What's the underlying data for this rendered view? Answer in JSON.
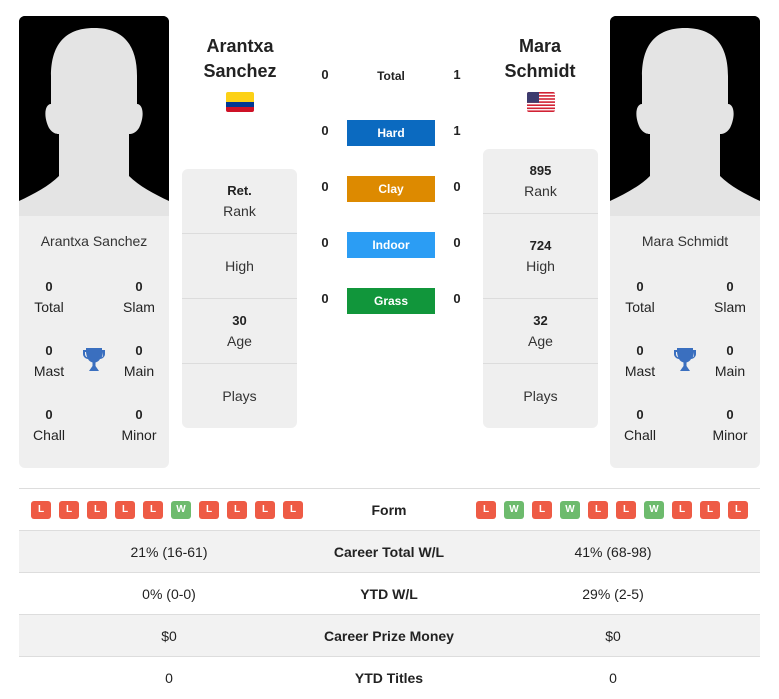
{
  "colors": {
    "hard": "#0b6ac0",
    "clay": "#dd8a00",
    "indoor": "#2b9df4",
    "grass": "#11963b",
    "loss": "#ee5b45",
    "win": "#6dbb6d",
    "trophy": "#3a6fbf"
  },
  "player1": {
    "first_name": "Arantxa",
    "last_name": "Sanchez",
    "full_name": "Arantxa Sanchez",
    "flag": "colombia-flag",
    "rank_value": "Ret.",
    "rank_label": "Rank",
    "high_value": "",
    "high_label": "High",
    "age_value": "30",
    "age_label": "Age",
    "plays_label": "Plays",
    "titles": {
      "total": "0",
      "total_label": "Total",
      "slam": "0",
      "slam_label": "Slam",
      "mast": "0",
      "mast_label": "Mast",
      "main": "0",
      "main_label": "Main",
      "chall": "0",
      "chall_label": "Chall",
      "minor": "0",
      "minor_label": "Minor"
    },
    "form": [
      "L",
      "L",
      "L",
      "L",
      "L",
      "W",
      "L",
      "L",
      "L",
      "L"
    ]
  },
  "player2": {
    "first_name": "Mara",
    "last_name": "Schmidt",
    "full_name": "Mara Schmidt",
    "flag": "usa-flag",
    "rank_value": "895",
    "rank_label": "Rank",
    "high_value": "724",
    "high_label": "High",
    "age_value": "32",
    "age_label": "Age",
    "plays_label": "Plays",
    "titles": {
      "total": "0",
      "total_label": "Total",
      "slam": "0",
      "slam_label": "Slam",
      "mast": "0",
      "mast_label": "Mast",
      "main": "0",
      "main_label": "Main",
      "chall": "0",
      "chall_label": "Chall",
      "minor": "0",
      "minor_label": "Minor"
    },
    "form": [
      "L",
      "W",
      "L",
      "W",
      "L",
      "L",
      "W",
      "L",
      "L",
      "L"
    ]
  },
  "h2h": {
    "total": {
      "label": "Total",
      "p1": "0",
      "p2": "1"
    },
    "surfaces": [
      {
        "label": "Hard",
        "p1": "0",
        "p2": "1"
      },
      {
        "label": "Clay",
        "p1": "0",
        "p2": "0"
      },
      {
        "label": "Indoor",
        "p1": "0",
        "p2": "0"
      },
      {
        "label": "Grass",
        "p1": "0",
        "p2": "0"
      }
    ]
  },
  "comparison": {
    "form_label": "Form",
    "rows": [
      {
        "label": "Career Total W/L",
        "p1": "21% (16-61)",
        "p2": "41% (68-98)"
      },
      {
        "label": "YTD W/L",
        "p1": "0% (0-0)",
        "p2": "29% (2-5)"
      },
      {
        "label": "Career Prize Money",
        "p1": "$0",
        "p2": "$0"
      },
      {
        "label": "YTD Titles",
        "p1": "0",
        "p2": "0"
      }
    ]
  }
}
